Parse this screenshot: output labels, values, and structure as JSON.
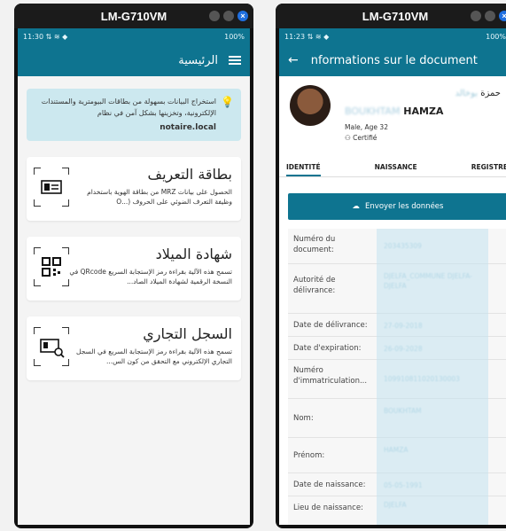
{
  "left": {
    "window_title": "LM-G710VM",
    "status": {
      "time": "11:30",
      "signal": "⇅ ≋ ◆",
      "battery": "100%"
    },
    "header": {
      "title": "الرئيسية"
    },
    "info": {
      "text": "استخراج البيانات بسهولة من بطاقات البيومترية والمستندات الإلكترونية، وتخزينها بشكل آمن في نظام",
      "link": "notaire.local"
    },
    "cards": [
      {
        "title": "بطاقة التعريف",
        "desc": "الحصول على بيانات MRZ من بطاقة الهوية باستخدام وظيفة التعرف الضوئي على الحروف (...O",
        "icon": "id-card-icon"
      },
      {
        "title": "شهادة الميلاد",
        "desc": "تسمح هذه الآلية بقراءة رمز الإستجابة السريع QRcode في النسخة الرقمية لشهادة الميلاد الصاد...",
        "icon": "qr-code-icon"
      },
      {
        "title": "السجل التجاري",
        "desc": "تسمح هذه الآلية بقراءة رمز الإستجابة السريع في السجل التجاري الإلكتروني مع التحقق من كون الس...",
        "icon": "id-search-icon"
      }
    ]
  },
  "right": {
    "window_title": "LM-G710VM",
    "status": {
      "time": "11:23",
      "signal": "⇅ ≋ ◆",
      "battery": "100%"
    },
    "header": {
      "title": "nformations sur le document"
    },
    "profile": {
      "name_ar": "حمزة",
      "name_ar_blurred": "بوخالد",
      "name_lat_blurred": "BOUKHTAM",
      "name_lat": "HAMZA",
      "gender_age": "Male, Age 32",
      "certified": "Certifié"
    },
    "tabs": [
      "IDENTITÉ",
      "NAISSANCE",
      "REGISTRE"
    ],
    "send_button": "Envoyer les données",
    "rows": [
      {
        "label": "Numéro du document:",
        "value": "203435309"
      },
      {
        "label": "Autorité de délivrance:",
        "value": "DJELFA_COMMUNE DJELFA-DJELFA"
      },
      {
        "label": "Date de délivrance:",
        "value": "27-09-2018"
      },
      {
        "label": "Date d'expiration:",
        "value": "26-09-2028"
      },
      {
        "label": "Numéro d'immatriculation...",
        "value": "109910811020130003"
      },
      {
        "label": "Nom:",
        "value": "BOUKHTAM"
      },
      {
        "label": "Prénom:",
        "value": "HAMZA"
      },
      {
        "label": "Date de naissance:",
        "value": "05-05-1991"
      },
      {
        "label": "Lieu de naissance:",
        "value": "DJELFA"
      }
    ]
  },
  "colors": {
    "primary": "#0e7490",
    "info_bg": "#cce8ef"
  }
}
